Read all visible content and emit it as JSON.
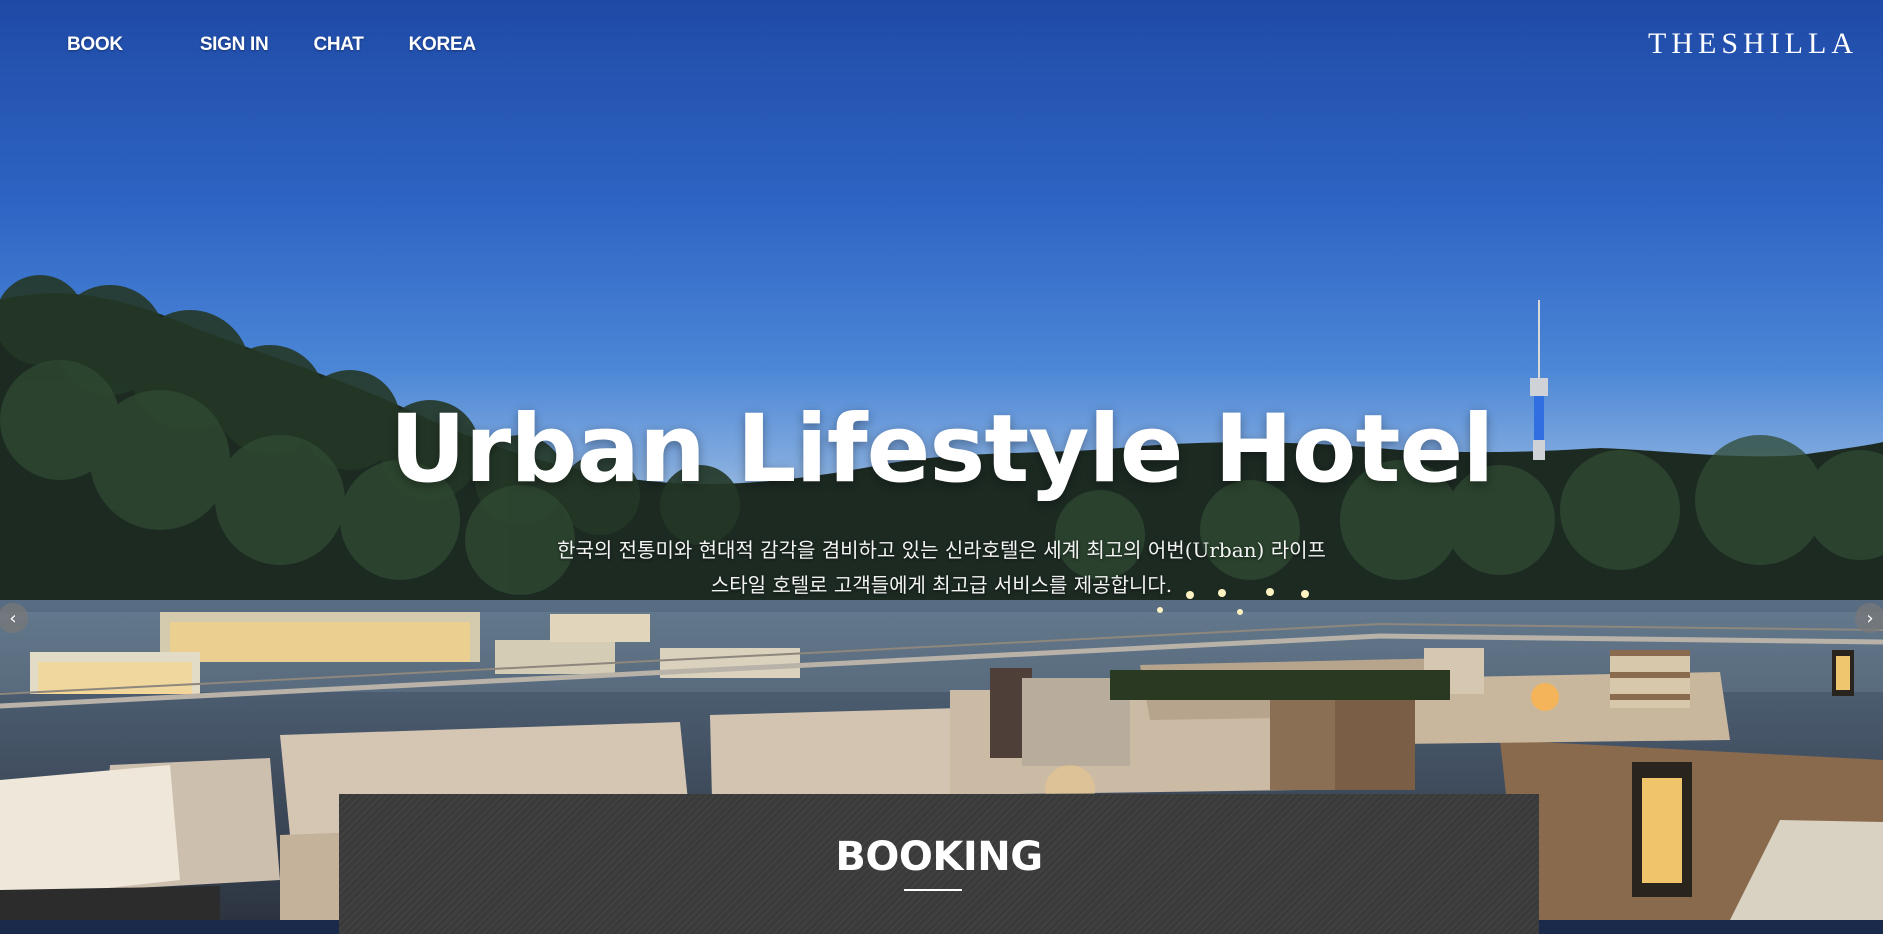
{
  "nav": {
    "items": [
      "BOOK",
      "SIGN IN",
      "CHAT",
      "KOREA"
    ]
  },
  "brand": {
    "logo_text": "THESHILLA"
  },
  "hero": {
    "title": "Urban Lifestyle Hotel",
    "description_lines": [
      "한국의 전통미와 현대적 감각을 겸비하고 있는 신라호텔은 세계 최고의 어번(Urban) 라이프",
      "스타일 호텔로 고객들에게 최고급 서비스를 제공합니다."
    ]
  },
  "slider": {
    "prev_icon": "chevron-left-icon",
    "next_icon": "chevron-right-icon",
    "prev_glyph": "‹",
    "next_glyph": "›"
  },
  "booking": {
    "title": "BOOKING"
  },
  "colors": {
    "text": "#ffffff",
    "booking_bg": "#3c3c3c",
    "arrow_bg": "#787878"
  }
}
